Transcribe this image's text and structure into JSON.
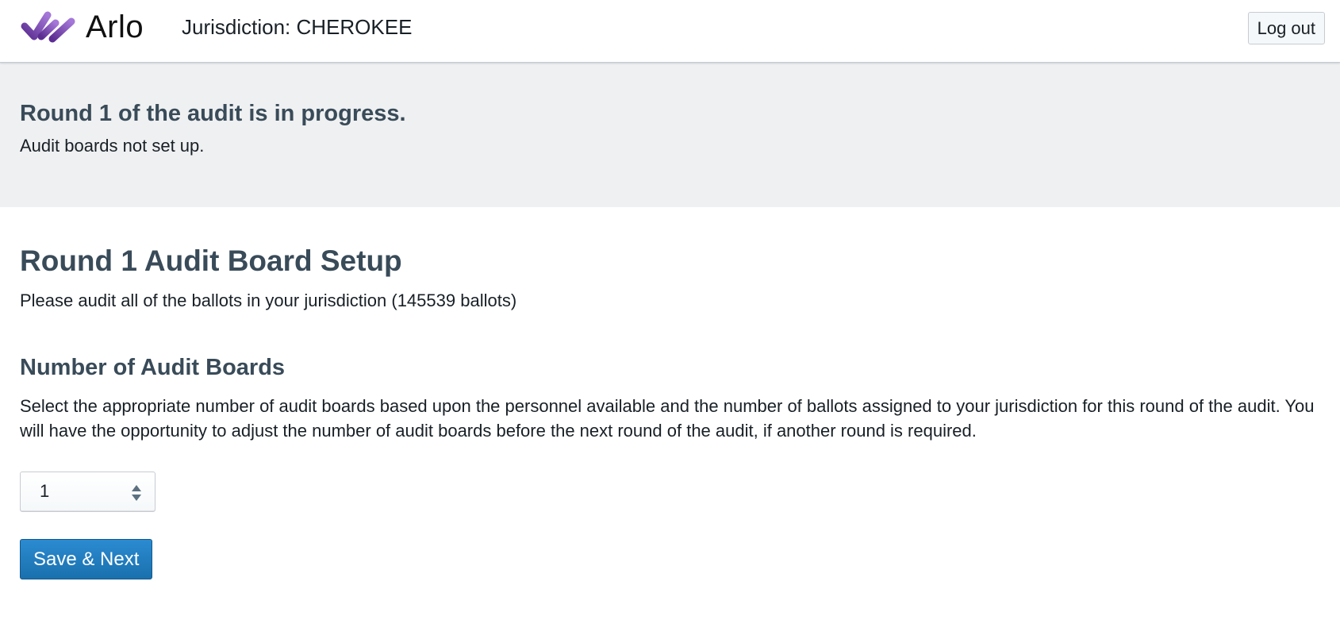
{
  "header": {
    "app_name": "Arlo",
    "logo_icon": "arlo-checkmark-logo-icon",
    "jurisdiction_label": "Jurisdiction: CHEROKEE",
    "logout_label": "Log out"
  },
  "status": {
    "title": "Round 1 of the audit is in progress.",
    "subtitle": "Audit boards not set up."
  },
  "setup": {
    "title": "Round 1 Audit Board Setup",
    "description": "Please audit all of the ballots in your jurisdiction (145539 ballots)"
  },
  "audit_boards": {
    "title": "Number of Audit Boards",
    "description": "Select the appropriate number of audit boards based upon the personnel available and the number of ballots assigned to your jurisdiction for this round of the audit. You will have the opportunity to adjust the number of audit boards before the next round of the audit, if another round is required.",
    "selected_value": "1",
    "caret_icon": "up-down-caret-icon"
  },
  "actions": {
    "save_label": "Save & Next"
  },
  "colors": {
    "brand_purple": "#7b4fb8",
    "heading": "#394b59",
    "primary_button": "#1e7bbe",
    "banner_bg": "#eff0f1"
  }
}
